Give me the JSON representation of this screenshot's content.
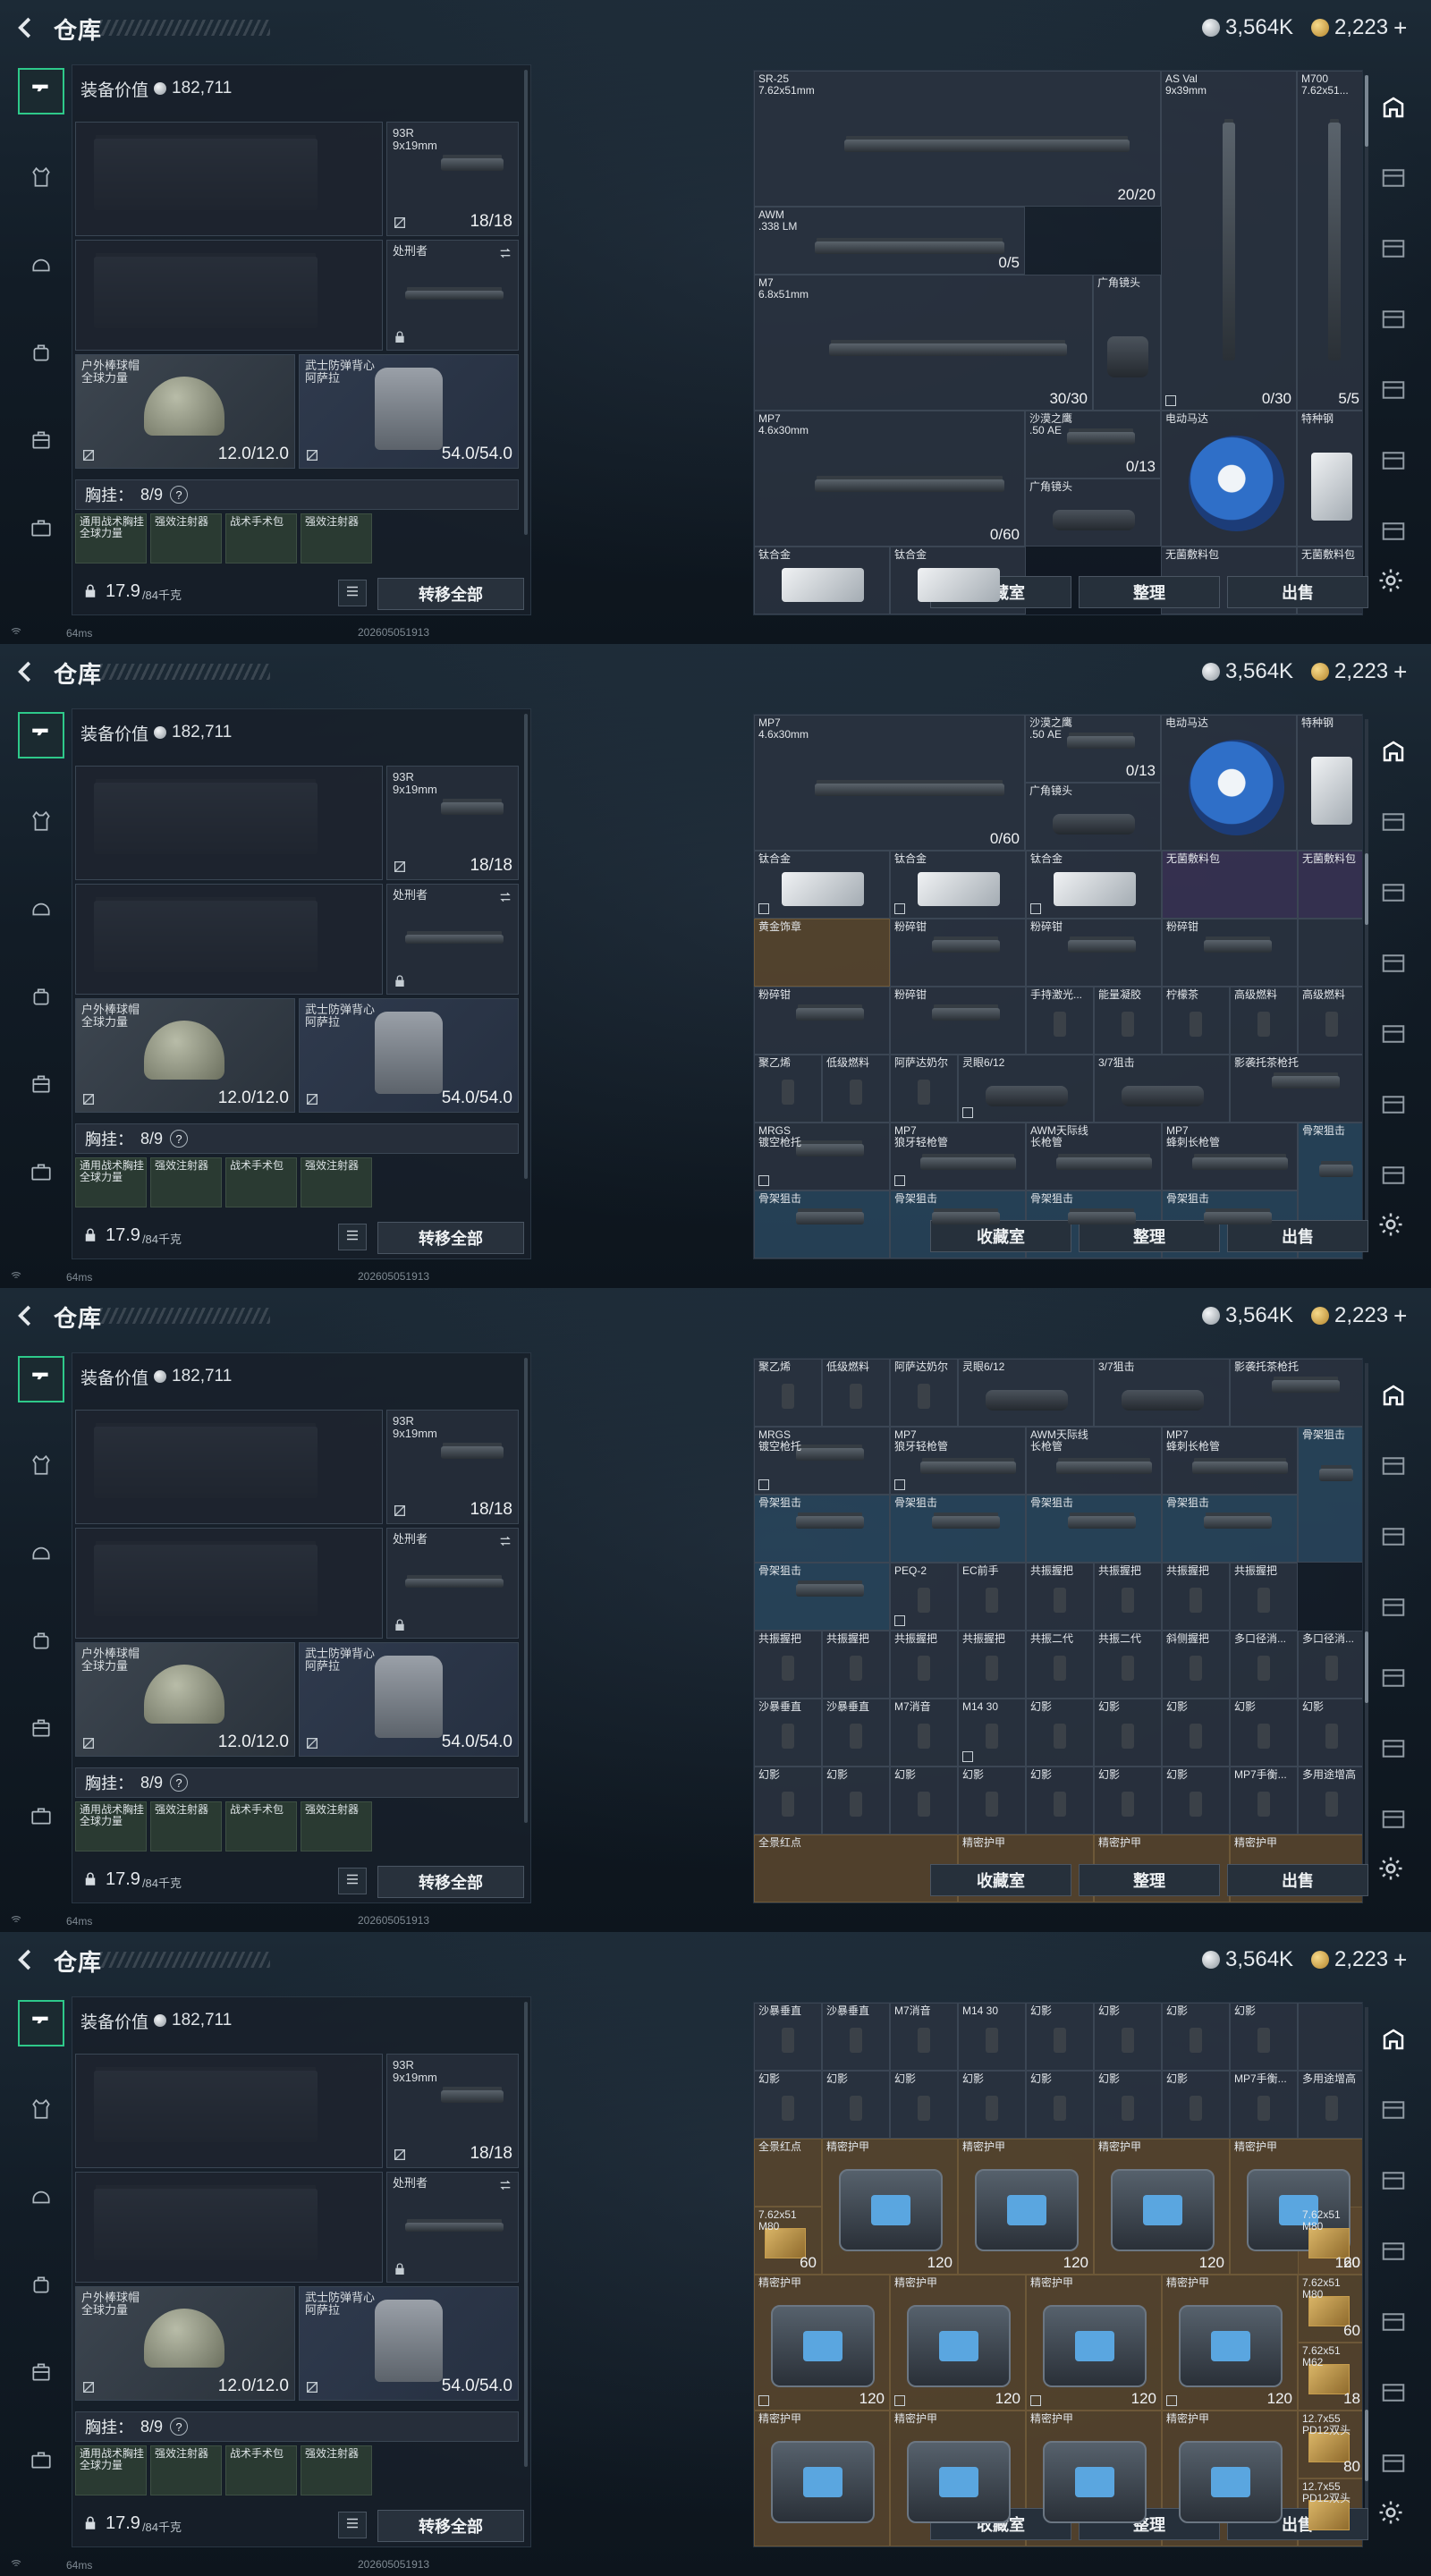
{
  "header": {
    "title": "仓库"
  },
  "currency": {
    "silver": "3,564K",
    "gold": "2,223",
    "gold_plus": "+"
  },
  "loadout": {
    "equip_value_label": "装备价值",
    "equip_value": "182,711",
    "primary_slot": {
      "name": "",
      "count": ""
    },
    "sidearm": {
      "name": "93R",
      "caliber": "9x19mm",
      "count": "18/18"
    },
    "melee": {
      "name": "处刑者"
    },
    "helmet": {
      "name": "户外棒球帽",
      "sub": "全球力量",
      "durability": "12.0/12.0"
    },
    "armor": {
      "name": "武士防弹背心",
      "sub": "阿萨拉",
      "durability": "54.0/54.0"
    },
    "vest_label": "胸挂：",
    "vest_capacity": "8/9",
    "help": "?",
    "vest_items": [
      "通用战术胸挂 全球力量",
      "强效注射器",
      "战术手术包",
      "强效注射器"
    ],
    "weight": "17.9",
    "weight_unit": "/84千克",
    "transfer_all": "转移全部"
  },
  "status": {
    "ping": "64ms",
    "build": "202605051913"
  },
  "footer_buttons": {
    "collection": "收藏室",
    "organize": "整理",
    "sell": "出售"
  },
  "stash_views": [
    {
      "offset": 0,
      "cells": [
        {
          "name": "SR-25\n7.62x51mm",
          "count": "20/20",
          "style": "",
          "art": "rifle"
        },
        {
          "name": "AS Val\n9x39mm",
          "count": "0/30",
          "style": "",
          "art": "rifle-v"
        },
        {
          "name": "M700\n7.62x51...",
          "count": "5/5",
          "style": "",
          "art": "rifle-v"
        },
        {
          "name": "AWM\n.338 LM",
          "count": "0/5",
          "style": "",
          "art": "rifle"
        },
        {
          "name": "M7\n6.8x51mm",
          "count": "30/30",
          "style": "",
          "art": "rifle"
        },
        {
          "name": "广角镜头",
          "count": "",
          "style": "",
          "art": "scope"
        },
        {
          "name": "MP7\n4.6x30mm",
          "count": "0/60",
          "style": "",
          "art": "rifle"
        },
        {
          "name": "沙漠之鹰\n.50 AE",
          "count": "0/13",
          "style": "",
          "art": "gun"
        },
        {
          "name": "电动马达",
          "count": "",
          "style": "blue",
          "art": "motor"
        },
        {
          "name": "特种钢",
          "count": "",
          "style": "",
          "art": "bar"
        },
        {
          "name": "广角镜头",
          "count": "",
          "style": "",
          "art": "scope"
        },
        {
          "name": "钛合金",
          "count": "",
          "style": "",
          "art": "bar"
        },
        {
          "name": "钛合金",
          "count": "",
          "style": "",
          "art": "bar"
        },
        {
          "name": "无菌敷料包",
          "count": "",
          "style": "purple",
          "art": ""
        },
        {
          "name": "无菌敷料包",
          "count": "",
          "style": "purple",
          "art": ""
        }
      ]
    }
  ],
  "row_labels": {
    "r1": [
      "钛合金",
      "钛合金",
      "钛合金",
      "无菌敷料包",
      "无菌敷料包"
    ],
    "r2": [
      "黄金饰章",
      "粉碎钳",
      "粉碎钳",
      "粉碎钳",
      ""
    ],
    "r3": [
      "粉碎钳",
      "粉碎钳",
      "手持激光...",
      "能量凝胶",
      "柠檬茶",
      "高级燃料",
      "高级燃料"
    ],
    "r4": [
      "聚乙烯",
      "低级燃料",
      "阿萨达奶尔",
      "灵眼6/12",
      "3/7狙击",
      "影袭托茶枪托"
    ],
    "r5": [
      "MRGS\n镀空枪托",
      "MP7\n狼牙轻枪管",
      "AWM天际线\n长枪管",
      "MP7\n蜂刺长枪管",
      "骨架狙击"
    ],
    "r6": [
      "骨架狙击",
      "骨架狙击",
      "骨架狙击",
      "骨架狙击",
      "骨架狙击"
    ],
    "r7": [
      "骨架狙击",
      "PEQ-2",
      "EC前手",
      "共振握把",
      "共振握把",
      "共振握把",
      "共振握把"
    ],
    "r8": [
      "共振握把",
      "共振握把",
      "共振握把",
      "共振握把",
      "共振二代",
      "共振二代",
      "斜侧握把",
      "多口径消...",
      "多口径消..."
    ],
    "r9": [
      "沙暴垂直",
      "沙暴垂直",
      "M7消音",
      "M14 30",
      "幻影",
      "幻影",
      "幻影",
      "幻影"
    ],
    "r10": [
      "幻影",
      "幻影",
      "幻影",
      "幻影",
      "幻影",
      "幻影",
      "幻影",
      "MP7手衡...",
      "多用途增高"
    ],
    "r11": [
      "全景红点",
      "精密护甲",
      "精密护甲",
      "精密护甲"
    ],
    "armor_row": [
      "精密护甲",
      "精密护甲",
      "精密护甲",
      "精密护甲"
    ],
    "armor_count": "120",
    "ammo": [
      {
        "name": "7.62x51\nM80",
        "count": "60"
      },
      {
        "name": "7.62x51\nM80",
        "count": "60"
      },
      {
        "name": "7.62x51\nM62",
        "count": "18"
      },
      {
        "name": "12.7x55\nPD12双头",
        "count": "80"
      },
      {
        "name": "12.7x55\nPD12双头",
        "count": ""
      }
    ]
  }
}
